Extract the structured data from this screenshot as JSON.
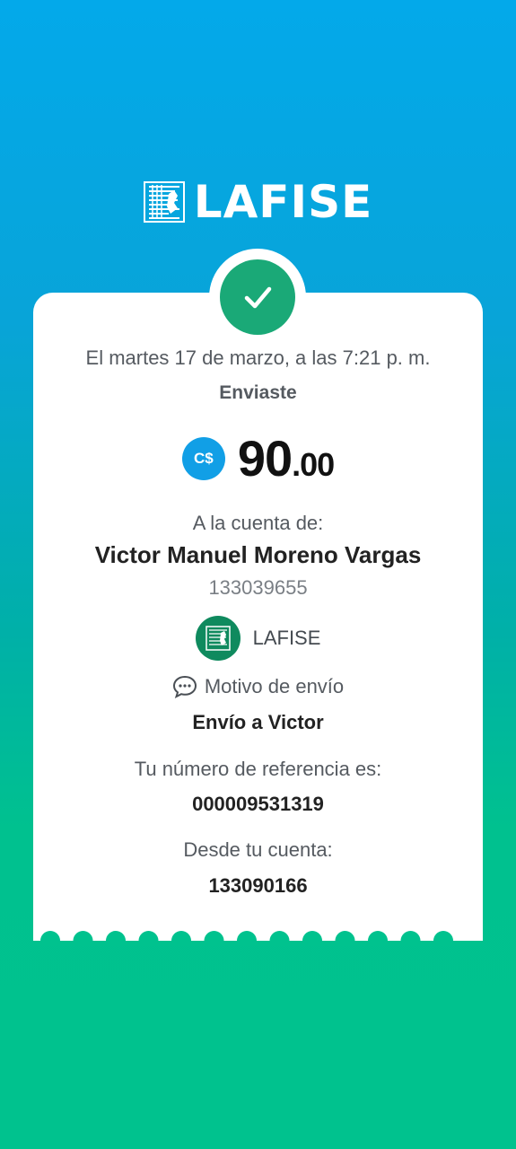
{
  "brand": {
    "name": "LAFISE",
    "logo_icon": "lafise-map-logo-icon"
  },
  "status": {
    "icon": "checkmark-icon",
    "color": "#1aa977"
  },
  "transaction": {
    "date_text": "El martes 17 de marzo, a las 7:21 p. m.",
    "action": "Enviaste",
    "currency_badge": "C$",
    "amount_integer": "90",
    "amount_decimal": ".00"
  },
  "recipient": {
    "label": "A la cuenta de:",
    "name": "Victor Manuel Moreno Vargas",
    "account": "133039655",
    "bank_name": "LAFISE",
    "bank_icon": "lafise-bank-icon"
  },
  "reason": {
    "icon": "speech-bubble-icon",
    "label": "Motivo de envío",
    "value": "Envío a Victor"
  },
  "reference": {
    "label": "Tu número de referencia es:",
    "value": "000009531319"
  },
  "source": {
    "label": "Desde tu cuenta:",
    "value": "133090166"
  },
  "colors": {
    "gradient_top": "#03a9ea",
    "gradient_bottom": "#00c28e",
    "currency_badge": "#119fe6",
    "bank_icon": "#0f8a5e"
  }
}
